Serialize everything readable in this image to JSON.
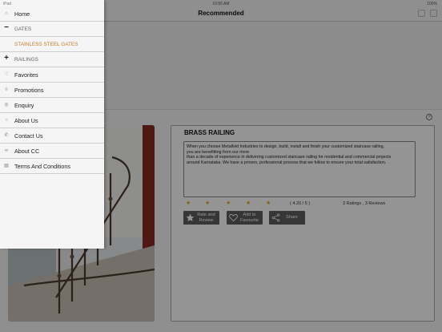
{
  "status_bar": {
    "carrier": "iPad",
    "time": "10:55 AM",
    "battery": "100%"
  },
  "nav": {
    "title": "Recommended"
  },
  "product": {
    "name": "BRASS RAILING",
    "description_lines": [
      "When you choose Metalloid Industries to design, build, install and finish your customized staircase railing,",
      "you are benefitting from our more",
      "than a decade of experience in delivering customized staircase railing for residential and commercial projects",
      "around Karnataka. We have a proven, professional process that we follow to ensure your total satisfaction."
    ],
    "rating_value": "( 4.20 / 5 )",
    "rating_count": "3 Ratings , 3 Reviews",
    "stars": 5,
    "star_color": "#e0a81d"
  },
  "actions": {
    "rate_review": {
      "line1": "Rate and",
      "line2": "Review"
    },
    "favourite": {
      "line1": "Add to",
      "line2": "Favourite"
    },
    "share": {
      "label": "Share"
    }
  },
  "menu": {
    "items": [
      {
        "label": "Home",
        "icon": "home-icon"
      },
      {
        "label": "GATES",
        "icon": "minus-icon"
      },
      {
        "label": "STAINLESS STEEL GATES"
      },
      {
        "label": "RAILINGS",
        "icon": "plus-icon"
      },
      {
        "label": "Favorites",
        "icon": "heart-icon"
      },
      {
        "label": "Promotions",
        "icon": "bell-icon"
      },
      {
        "label": "Enquiry",
        "icon": "enquiry-icon"
      },
      {
        "label": "About Us",
        "icon": "info-icon"
      },
      {
        "label": "Contact Us",
        "icon": "phone-icon"
      },
      {
        "label": "About CC",
        "icon": "link-icon"
      },
      {
        "label": "Terms And Conditions",
        "icon": "document-icon"
      }
    ]
  },
  "colors": {
    "accent_sub": "#c67a2c",
    "button_bg": "#5e5e5e",
    "overlay": "rgba(0,0,0,0.42)"
  }
}
